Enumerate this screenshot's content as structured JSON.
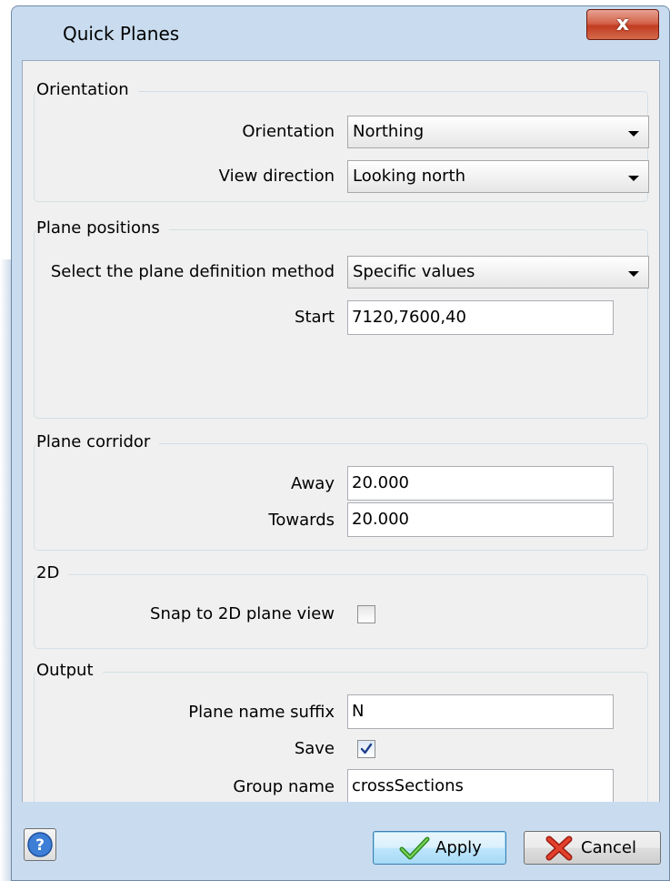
{
  "window": {
    "title": "Quick Planes",
    "close_symbol": "x"
  },
  "orientation_group": {
    "legend": "Orientation",
    "orientation_label": "Orientation",
    "orientation_value": "Northing",
    "view_direction_label": "View direction",
    "view_direction_value": "Looking north"
  },
  "plane_positions_group": {
    "legend": "Plane positions",
    "method_label": "Select the plane definition method",
    "method_value": "Specific values",
    "start_label": "Start",
    "start_value": "7120,7600,40"
  },
  "plane_corridor_group": {
    "legend": "Plane corridor",
    "away_label": "Away",
    "away_value": "20.000",
    "towards_label": "Towards",
    "towards_value": "20.000"
  },
  "twod_group": {
    "legend": "2D",
    "snap_label": "Snap to 2D plane view",
    "snap_checked": false
  },
  "output_group": {
    "legend": "Output",
    "suffix_label": "Plane name suffix",
    "suffix_value": "N",
    "save_label": "Save",
    "save_checked": true,
    "group_name_label": "Group name",
    "group_name_value": "crossSections"
  },
  "buttons": {
    "apply_label": "Apply",
    "cancel_label": "Cancel"
  },
  "icons": {
    "help": "help-icon",
    "apply": "checkmark-icon",
    "cancel": "red-x-icon",
    "close": "close-icon",
    "dropdown": "chevron-down-icon"
  },
  "colors": {
    "titlebar": "#c9dcef",
    "close_button": "#c13d22",
    "dialog_bg": "#f0f0f0"
  }
}
